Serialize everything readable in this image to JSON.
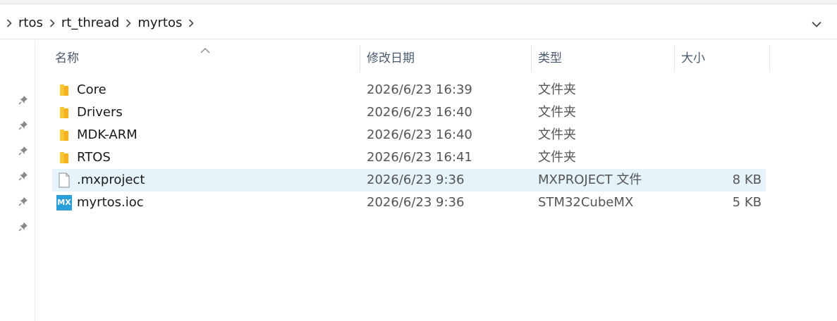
{
  "breadcrumb": {
    "items": [
      "rtos",
      "rt_thread",
      "myrtos"
    ]
  },
  "columns": {
    "name": "名称",
    "date": "修改日期",
    "type": "类型",
    "size": "大小"
  },
  "files": [
    {
      "name": "Core",
      "date": "2026/6/23 16:39",
      "type": "文件夹",
      "size": "",
      "icon": "folder-icon"
    },
    {
      "name": "Drivers",
      "date": "2026/6/23 16:40",
      "type": "文件夹",
      "size": "",
      "icon": "folder-icon"
    },
    {
      "name": "MDK-ARM",
      "date": "2026/6/23 16:40",
      "type": "文件夹",
      "size": "",
      "icon": "folder-icon"
    },
    {
      "name": "RTOS",
      "date": "2026/6/23 16:41",
      "type": "文件夹",
      "size": "",
      "icon": "folder-icon"
    },
    {
      "name": ".mxproject",
      "date": "2026/6/23 9:36",
      "type": "MXPROJECT 文件",
      "size": "8 KB",
      "icon": "blank-file-icon"
    },
    {
      "name": "myrtos.ioc",
      "date": "2026/6/23 9:36",
      "type": "STM32CubeMX",
      "size": "5 KB",
      "icon": "stm32cubemx-file-icon",
      "icon_text": "MX"
    }
  ],
  "colors": {
    "selection": "#e5f3fb",
    "folder": "#f8c53a",
    "mx_badge": "#2b9fd9"
  }
}
